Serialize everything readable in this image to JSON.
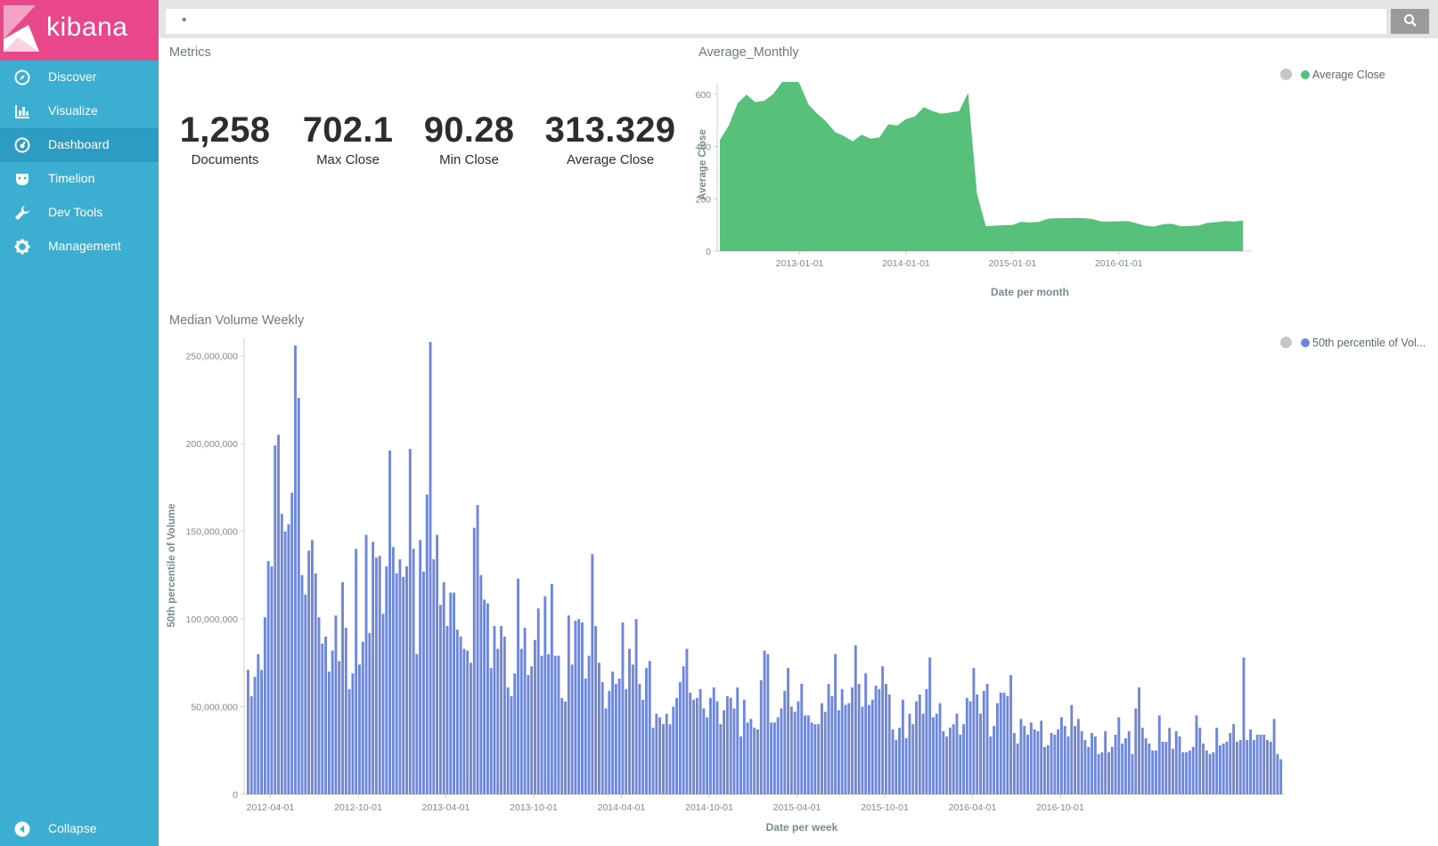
{
  "app": {
    "logo_text": "kibana"
  },
  "nav": {
    "items": [
      {
        "label": "Discover",
        "icon": "compass-icon"
      },
      {
        "label": "Visualize",
        "icon": "bar-chart-icon"
      },
      {
        "label": "Dashboard",
        "icon": "dashboard-icon",
        "active": true
      },
      {
        "label": "Timelion",
        "icon": "timelion-icon"
      },
      {
        "label": "Dev Tools",
        "icon": "wrench-icon"
      },
      {
        "label": "Management",
        "icon": "gear-icon"
      }
    ],
    "collapse_label": "Collapse"
  },
  "search": {
    "value": "*"
  },
  "metrics_panel": {
    "title": "Metrics",
    "metrics": [
      {
        "value": "1,258",
        "label": "Documents"
      },
      {
        "value": "702.1",
        "label": "Max Close"
      },
      {
        "value": "90.28",
        "label": "Min Close"
      },
      {
        "value": "313.329",
        "label": "Average Close"
      }
    ]
  },
  "area_panel": {
    "title": "Average_Monthly",
    "legend_label": "Average Close",
    "legend_color": "#57c17b"
  },
  "bar_panel": {
    "title": "Median Volume Weekly",
    "legend_label": "50th percentile of Vol...",
    "legend_color": "#6f87d8"
  },
  "chart_data": [
    {
      "type": "area",
      "title": "Average_Monthly",
      "xlabel": "Date per month",
      "ylabel": "Average Close",
      "x_ticks": [
        "2013-01-01",
        "2014-01-01",
        "2015-01-01",
        "2016-01-01"
      ],
      "y_ticks": [
        0,
        200,
        400,
        600
      ],
      "ylim": [
        0,
        640
      ],
      "series": [
        {
          "name": "Average Close",
          "color": "#57c17b",
          "values": [
            425,
            480,
            565,
            598,
            570,
            575,
            600,
            645,
            680,
            640,
            560,
            525,
            495,
            455,
            440,
            420,
            445,
            430,
            435,
            485,
            480,
            505,
            515,
            550,
            535,
            525,
            530,
            535,
            605,
            220,
            95,
            97,
            99,
            100,
            112,
            110,
            112,
            124,
            126,
            126,
            127,
            126,
            123,
            113,
            113,
            114,
            115,
            107,
            97,
            94,
            103,
            105,
            95,
            96,
            98,
            108,
            111,
            115,
            113,
            117
          ]
        }
      ]
    },
    {
      "type": "bar",
      "title": "Median Volume Weekly",
      "xlabel": "Date per week",
      "ylabel": "50th percentile of Volume",
      "x_ticks": [
        "2012-04-01",
        "2012-10-01",
        "2013-04-01",
        "2013-10-01",
        "2014-04-01",
        "2014-10-01",
        "2015-04-01",
        "2015-10-01",
        "2016-04-01",
        "2016-10-01"
      ],
      "y_ticks": [
        "0",
        "50,000,000",
        "100,000,000",
        "150,000,000",
        "200,000,000",
        "250,000,000"
      ],
      "ylim": [
        0,
        260000000
      ],
      "series": [
        {
          "name": "50th percentile of Volume",
          "color": "#6f87d8",
          "values": [
            71,
            56,
            67,
            80,
            71,
            101,
            133,
            130,
            199,
            205,
            160,
            150,
            154,
            172,
            256,
            226,
            125,
            114,
            139,
            145,
            126,
            101,
            86,
            90,
            70,
            82,
            102,
            76,
            121,
            95,
            60,
            69,
            140,
            74,
            87,
            148,
            92,
            144,
            135,
            136,
            103,
            130,
            196,
            141,
            126,
            134,
            124,
            130,
            197,
            140,
            80,
            145,
            127,
            171,
            258,
            134,
            148,
            108,
            121,
            96,
            115,
            115,
            94,
            90,
            83,
            82,
            75,
            152,
            165,
            125,
            111,
            109,
            72,
            96,
            83,
            96,
            90,
            61,
            56,
            69,
            123,
            83,
            95,
            68,
            73,
            88,
            106,
            79,
            113,
            80,
            120,
            79,
            79,
            55,
            53,
            102,
            74,
            99,
            100,
            98,
            66,
            79,
            137,
            96,
            75,
            64,
            49,
            59,
            70,
            63,
            66,
            98,
            60,
            83,
            74,
            100,
            63,
            54,
            72,
            76,
            38,
            46,
            44,
            40,
            46,
            40,
            50,
            55,
            64,
            73,
            83,
            58,
            54,
            55,
            60,
            49,
            44,
            55,
            61,
            53,
            40,
            48,
            56,
            55,
            49,
            61,
            33,
            54,
            41,
            43,
            38,
            37,
            65,
            82,
            80,
            41,
            41,
            44,
            49,
            59,
            72,
            50,
            47,
            53,
            63,
            45,
            45,
            41,
            40,
            40,
            52,
            47,
            63,
            56,
            80,
            48,
            60,
            51,
            52,
            61,
            85,
            63,
            50,
            69,
            51,
            54,
            62,
            60,
            73,
            63,
            57,
            37,
            31,
            38,
            54,
            32,
            46,
            40,
            53,
            57,
            46,
            60,
            78,
            44,
            46,
            52,
            36,
            33,
            38,
            40,
            46,
            34,
            40,
            55,
            53,
            72,
            57,
            46,
            59,
            63,
            33,
            39,
            52,
            58,
            58,
            56,
            68,
            35,
            29,
            43,
            39,
            34,
            41,
            37,
            36,
            42,
            27,
            28,
            35,
            34,
            37,
            44,
            39,
            33,
            51,
            39,
            43,
            36,
            31,
            27,
            35,
            33,
            23,
            24,
            36,
            24,
            27,
            34,
            44,
            29,
            32,
            36,
            23,
            49,
            61,
            38,
            32,
            29,
            25,
            25,
            45,
            30,
            30,
            38,
            26,
            36,
            33,
            24,
            24,
            25,
            27,
            45,
            38,
            29,
            25,
            23,
            24,
            38,
            28,
            29,
            30,
            35,
            40,
            30,
            31,
            78,
            31,
            37,
            31,
            34,
            34,
            34,
            31,
            30,
            43,
            23,
            20
          ]
        }
      ]
    }
  ]
}
